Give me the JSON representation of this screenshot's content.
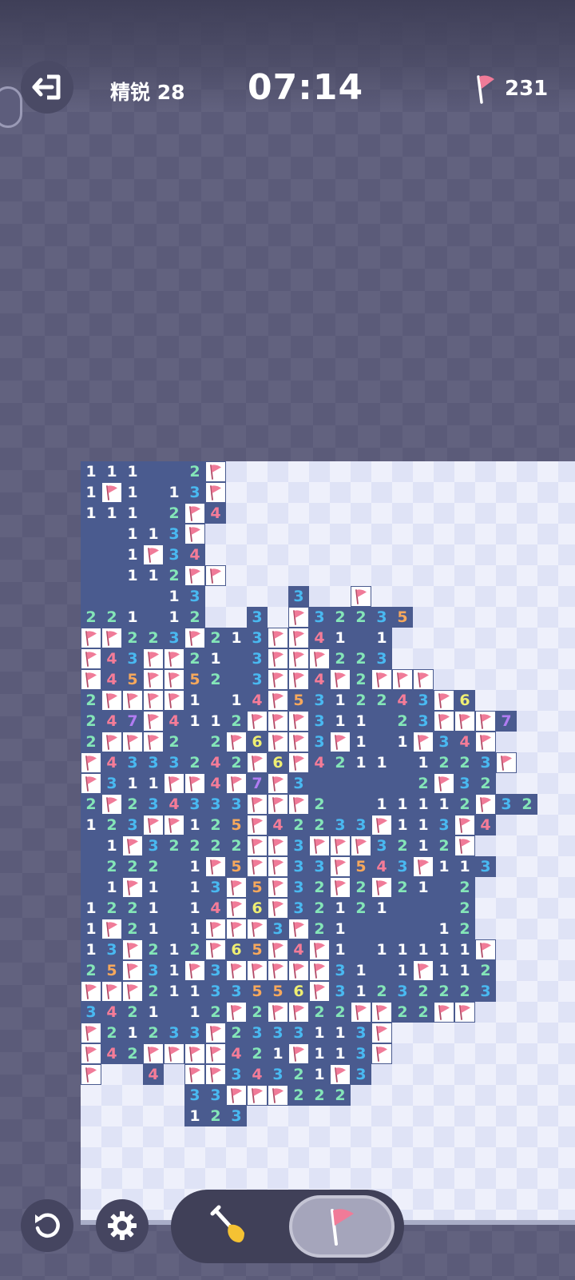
{
  "header": {
    "exit_icon": "exit-arrow-icon",
    "level_label": "精锐 28",
    "timer": "07:14",
    "flag_icon": "flag-icon",
    "flags_remaining": "231"
  },
  "colors": {
    "revealed": "#4a5b8f",
    "hidden_light": "#eef0fb",
    "hidden_dark": "#dfe3f6",
    "flag_bg": "#ffffff",
    "flag_red": "#f07b98",
    "n1": "#ffffff",
    "n2": "#84e6b8",
    "n3": "#49b9f1",
    "n4": "#f57c98",
    "n5": "#f6a85c",
    "n6": "#eeee72",
    "n7": "#b17cf2"
  },
  "board": {
    "legend": {
      "#": "hidden",
      ".": "revealed-empty",
      "F": "flag",
      "digit": "revealed-number"
    },
    "rows": [
      "111..2F#################",
      "1F1.13F#################",
      "111.2F4#################",
      "..113F##################",
      "..1F34##################",
      "..112FF#################",
      "....13####3##F##########",
      "221.12##3#F32235########",
      "FF223F213FF41.1#########",
      "F43FF21.3FFF223#########",
      "F45FF52.3FF4F2FFF#######",
      "2FFFF1.14F5312243F6#####",
      "247F4112FFF311.23FFF7###",
      "2FFF2.2F6FF3F1.1F34F####",
      "F4333242F6F4211.1223F###",
      "F311FF4F7F3.....2F32####",
      "2F234333FFF2..11112F32##",
      "123FF125F42233F113F4####",
      ".1F32222FF3FFF3212F#####",
      ".222.1F5FF33F543F113####",
      ".1F1.13F5F32F2F21.2#####",
      "1221.14F6F32121...2#####",
      "1F21.1FFF3F21....12#####",
      "13F212F65F4F1.11111F####",
      "25F31F3FFFFF31.1F112####",
      "FFF21133556F31232223####",
      "3421.12F2FF22FF22FF#####",
      "F21233F2333113F#########",
      "F42FFFF421F113F#########",
      "F##4#FF34321F3##########",
      "#####33FFF222###########",
      "#####123################",
      "########################",
      "########################",
      "########################",
      "########################",
      "########################"
    ]
  },
  "controls": {
    "undo_icon": "undo-icon",
    "settings_icon": "gear-icon",
    "dig_icon": "shovel-icon",
    "flag_mode_icon": "flag-icon"
  }
}
